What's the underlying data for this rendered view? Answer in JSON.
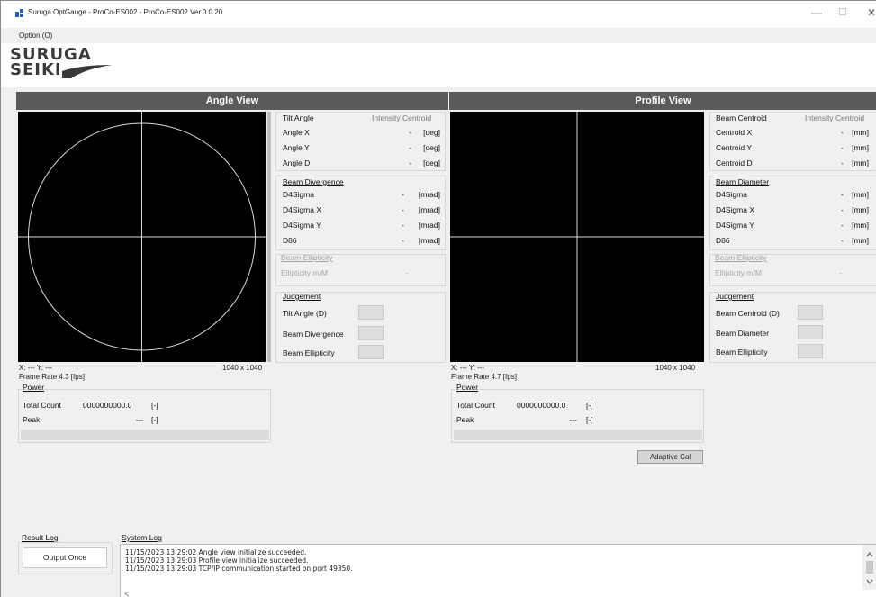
{
  "window": {
    "title": "Suruga OptGauge - ProCo-ES002 - ProCo-ES002 Ver.0.0.20",
    "controls": {
      "minimize": "—",
      "maximize": "☐",
      "close": "✕"
    }
  },
  "menu": {
    "items": [
      {
        "label": "Option (O)"
      }
    ]
  },
  "logo": {
    "line1": "SURUGA",
    "line2": "SEIKI"
  },
  "angle_view": {
    "header": "Angle View",
    "coords": "X: --- Y: ---",
    "resolution": "1040 x 1040",
    "frame_rate": "Frame Rate  4.3  [fps]",
    "tilt": {
      "title": "Tilt Angle",
      "mode": "Intensity Centroid",
      "rows": [
        {
          "label": "Angle X",
          "value": "-",
          "unit": "[deg]"
        },
        {
          "label": "Angle Y",
          "value": "-",
          "unit": "[deg]"
        },
        {
          "label": "Angle D",
          "value": "-",
          "unit": "[deg]"
        }
      ]
    },
    "divergence": {
      "title": "Beam Divergence",
      "rows": [
        {
          "label": "D4Sigma",
          "value": "-",
          "unit": "[mrad]"
        },
        {
          "label": "D4Sigma X",
          "value": "-",
          "unit": "[mrad]"
        },
        {
          "label": "D4Sigma Y",
          "value": "-",
          "unit": "[mrad]"
        },
        {
          "label": "D86",
          "value": "-",
          "unit": "[mrad]"
        }
      ]
    },
    "ellipticity": {
      "title": "Beam Ellipticity",
      "label": "Ellipticity m/M",
      "value": "-"
    },
    "judgement": {
      "title": "Judgement",
      "items": [
        {
          "label": "Tilt Angle (D)"
        },
        {
          "label": "Beam Divergence"
        },
        {
          "label": "Beam Ellipticity"
        }
      ]
    },
    "power": {
      "title": "Power",
      "total_label": "Total Count",
      "total_value": "0000000000.0",
      "total_unit": "[-]",
      "peak_label": "Peak",
      "peak_value": "---",
      "peak_unit": "[-]"
    }
  },
  "profile_view": {
    "header": "Profile View",
    "coords": "X: --- Y: ---",
    "resolution": "1040 x 1040",
    "frame_rate": "Frame Rate  4.7  [fps]",
    "centroid": {
      "title": "Beam Centroid",
      "mode": "Intensity Centroid",
      "rows": [
        {
          "label": "Centroid X",
          "value": "-",
          "unit": "[mm]"
        },
        {
          "label": "Centroid Y",
          "value": "-",
          "unit": "[mm]"
        },
        {
          "label": "Centroid D",
          "value": "-",
          "unit": "[mm]"
        }
      ]
    },
    "diameter": {
      "title": "Beam Diameter",
      "rows": [
        {
          "label": "D4Sigma",
          "value": "-",
          "unit": "[mm]"
        },
        {
          "label": "D4Sigma X",
          "value": "-",
          "unit": "[mm]"
        },
        {
          "label": "D4Sigma Y",
          "value": "-",
          "unit": "[mm]"
        },
        {
          "label": "D86",
          "value": "-",
          "unit": "[mm]"
        }
      ]
    },
    "ellipticity": {
      "title": "Beam Ellipticity",
      "label": "Ellipticity m/M",
      "value": "-"
    },
    "judgement": {
      "title": "Judgement",
      "items": [
        {
          "label": "Beam Centroid (D)"
        },
        {
          "label": "Beam Diameter"
        },
        {
          "label": "Beam Ellipticity"
        }
      ]
    },
    "power": {
      "title": "Power",
      "total_label": "Total Count",
      "total_value": "0000000000.0",
      "total_unit": "[-]",
      "peak_label": "Peak",
      "peak_value": "---",
      "peak_unit": "[-]"
    },
    "adaptive_cal": "Adaptive Cal"
  },
  "result_log": {
    "title": "Result Log",
    "button": "Output Once"
  },
  "system_log": {
    "title": "System Log",
    "lines": [
      "11/15/2023 13:29:02 Angle view initialize succeeded.",
      "11/15/2023 13:29:03 Profile view initialize succeeded.",
      "11/15/2023 13:29:03 TCP/IP communication started on port 49350."
    ]
  },
  "colors": {
    "header_bg": "#5a5a5a",
    "view_bg": "#000000",
    "crosshair": "#d9d9d9",
    "window_bg": "#f0f0f0"
  },
  "icons": {
    "app": "app-grid-icon",
    "scroll_up": "chevron-up-icon",
    "scroll_down": "chevron-down-icon",
    "scroll_left": "chevron-left-icon"
  }
}
